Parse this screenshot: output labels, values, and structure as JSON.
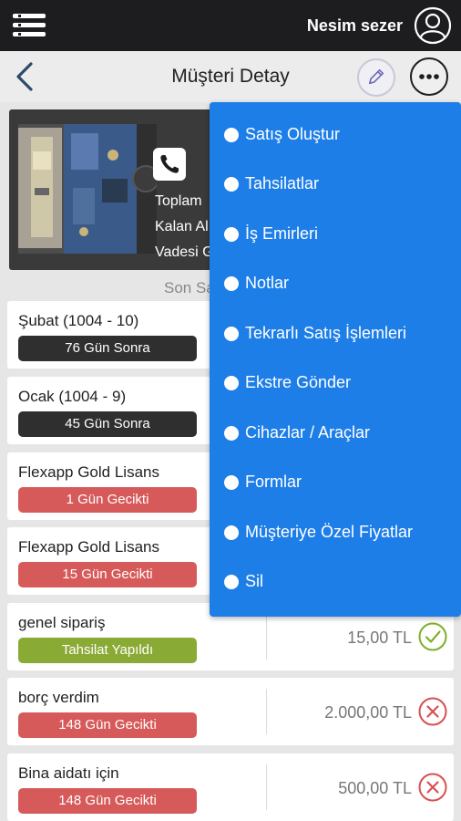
{
  "header": {
    "user_name": "Nesim sezer",
    "menu_icon": "hamburger-icon",
    "user_icon": "user-circle-icon"
  },
  "subheader": {
    "title": "Müşteri Detay",
    "back_icon": "chevron-left-icon",
    "edit_icon": "pencil-icon",
    "more_icon": "more-horizontal-icon"
  },
  "customer": {
    "phone_icon": "phone-icon",
    "lines": [
      "Toplam",
      "Kalan Al",
      "Vadesi G"
    ]
  },
  "section_label": "Son Sa",
  "rows": [
    {
      "title": "Şubat (1004 - 10)",
      "badge": "76 Gün Sonra",
      "badge_color": "#2f2f2f"
    },
    {
      "title": "Ocak (1004 - 9)",
      "badge": "45 Gün Sonra",
      "badge_color": "#2f2f2f"
    },
    {
      "title": "Flexapp Gold Lisans",
      "badge": "1 Gün Gecikti",
      "badge_color": "#d75a5a"
    },
    {
      "title": "Flexapp Gold Lisans",
      "badge": "15 Gün Gecikti",
      "badge_color": "#d75a5a"
    },
    {
      "title": "genel sipariş",
      "badge": "Tahsilat Yapıldı",
      "badge_color": "#8aaa36",
      "amount": "15,00 TL",
      "status_icon": "check-circle-icon",
      "status_color": "#7fb02a"
    },
    {
      "title": "borç verdim",
      "badge": "148 Gün Gecikti",
      "badge_color": "#d75a5a",
      "amount": "2.000,00 TL",
      "status_icon": "x-circle-icon",
      "status_color": "#d85050"
    },
    {
      "title": "Bina aidatı için",
      "badge": "148 Gün Gecikti",
      "badge_color": "#d75a5a",
      "amount": "500,00 TL",
      "status_icon": "x-circle-icon",
      "status_color": "#d85050"
    }
  ],
  "menu": {
    "color": "#1e7ee8",
    "items": [
      "Satış Oluştur",
      "Tahsilatlar",
      "İş Emirleri",
      "Notlar",
      "Tekrarlı Satış İşlemleri",
      "Ekstre Gönder",
      "Cihazlar / Araçlar",
      "Formlar",
      "Müşteriye Özel Fiyatlar",
      "Sil"
    ]
  }
}
